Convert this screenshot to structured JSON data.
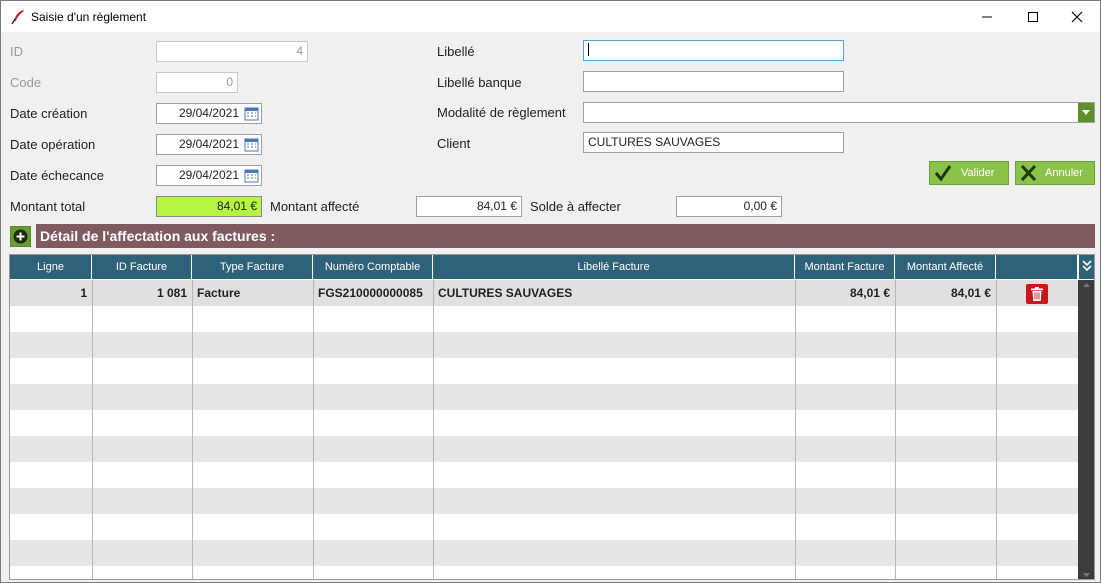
{
  "window": {
    "title": "Saisie d'un règlement"
  },
  "form": {
    "id": {
      "label": "ID",
      "value": "4"
    },
    "code": {
      "label": "Code",
      "value": "0"
    },
    "date_creation": {
      "label": "Date création",
      "value": "29/04/2021"
    },
    "date_operation": {
      "label": "Date opération",
      "value": "29/04/2021"
    },
    "date_echeance": {
      "label": "Date échecance",
      "value": "29/04/2021"
    },
    "montant_total": {
      "label": "Montant total",
      "value": "84,01 €"
    },
    "montant_affecte": {
      "label": "Montant affecté",
      "value": "84,01 €"
    },
    "solde_a_affecter": {
      "label": "Solde à affecter",
      "value": "0,00 €"
    },
    "libelle": {
      "label": "Libellé",
      "value": ""
    },
    "libelle_banque": {
      "label": "Libellé banque",
      "value": ""
    },
    "modalite": {
      "label": "Modalité de règlement",
      "value": ""
    },
    "client": {
      "label": "Client",
      "value": "CULTURES SAUVAGES"
    }
  },
  "actions": {
    "valider": "Valider",
    "annuler": "Annuler"
  },
  "section": {
    "title": "Détail de l'affectation aux factures :"
  },
  "grid": {
    "columns": [
      "Ligne",
      "ID Facture",
      "Type Facture",
      "Numéro Comptable",
      "Libellé Facture",
      "Montant Facture",
      "Montant Affecté",
      ""
    ],
    "rows": [
      {
        "ligne": "1",
        "id_facture": "1 081",
        "type_facture": "Facture",
        "numero_comptable": "FGS210000000085",
        "libelle_facture": "CULTURES SAUVAGES",
        "montant_facture": "84,01 €",
        "montant_affecte": "84,01 €"
      }
    ]
  },
  "colors": {
    "accent_green": "#8bc34a",
    "highlight_field": "#b6f542",
    "section_bar": "#7f5b60",
    "grid_header": "#2f6279",
    "delete_red": "#c8161d"
  },
  "icons": {
    "app": "quill-icon",
    "calendar": "calendar-icon",
    "valider": "check-icon",
    "annuler": "x-icon",
    "add": "plus-circle-icon",
    "delete": "trash-icon",
    "columns": "double-chevron-down-icon"
  }
}
